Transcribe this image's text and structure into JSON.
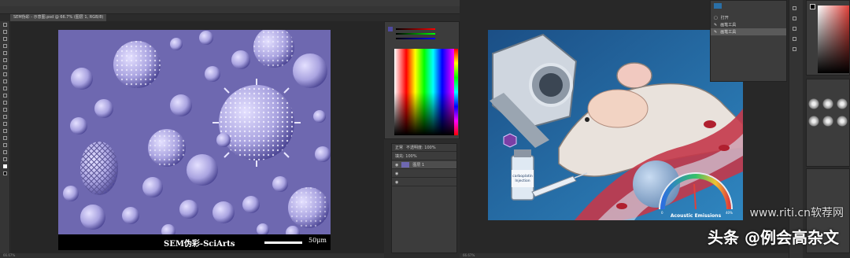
{
  "left_window": {
    "doc_tab": "SEM伪彩 - 示意图.psd @ 66.7% (图层 1, RGB/8)",
    "status": "66.67%",
    "image": {
      "caption": "SEM伪彩-SciArts",
      "scale_label": "50μm"
    },
    "layers": {
      "blend_mode": "正常",
      "opacity_label": "不透明度: 100%",
      "fill_label": "填充: 100%",
      "layer_name": "图层 1"
    }
  },
  "right_window": {
    "status": "66.67%",
    "history": [
      "打开",
      "画笔工具",
      "画笔工具"
    ],
    "illustration": {
      "vial_label_line1": "carboplatin",
      "vial_label_line2": "Injection",
      "gauge_label": "Acoustic Emissions",
      "gauge_min": "0",
      "gauge_max": "40%"
    }
  },
  "watermark": {
    "url": "www.riti.cn软荐网",
    "author": "头条 @例会高杂文"
  },
  "colors": {
    "sem_purple": "#6e68b0",
    "illus_blue": "#2a6fa6"
  }
}
